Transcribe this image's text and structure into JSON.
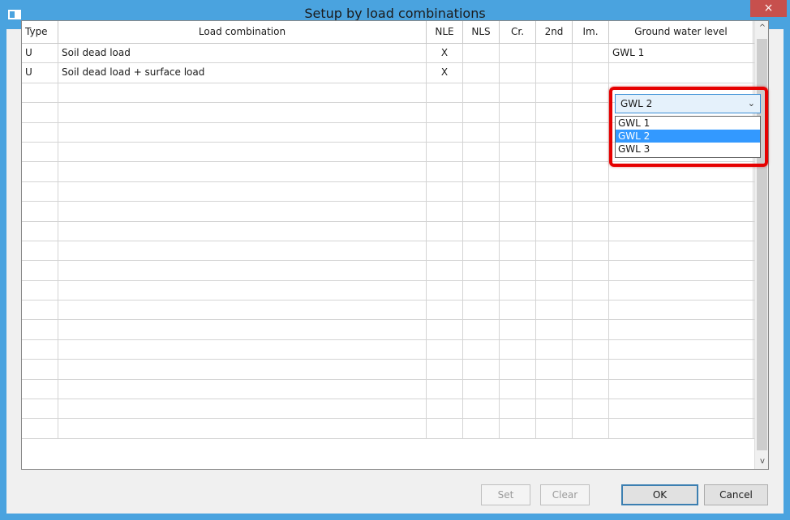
{
  "window": {
    "title": "Setup by load combinations",
    "close_glyph": "×"
  },
  "table": {
    "headers": {
      "type": "Type",
      "load_combination": "Load combination",
      "nle": "NLE",
      "nls": "NLS",
      "cr": "Cr.",
      "second": "2nd",
      "im": "Im.",
      "gwl": "Ground water level"
    },
    "rows": [
      {
        "type": "U",
        "load_combination": "Soil dead load",
        "nle": "X",
        "nls": "",
        "cr": "",
        "second": "",
        "im": "",
        "gwl": "GWL 1"
      },
      {
        "type": "U",
        "load_combination": "Soil dead load + surface load",
        "nle": "X",
        "nls": "",
        "cr": "",
        "second": "",
        "im": "",
        "gwl": ""
      }
    ],
    "empty_row_count": 18
  },
  "gwl_combo": {
    "value": "GWL 2",
    "options": [
      "GWL 1",
      "GWL 2",
      "GWL 3"
    ],
    "selected_index": 1
  },
  "scrollbar": {
    "up": "^",
    "down": "v"
  },
  "buttons": {
    "set": "Set",
    "clear": "Clear",
    "ok": "OK",
    "cancel": "Cancel"
  },
  "colors": {
    "titlebar": "#4aa3df",
    "highlight": "#e60000",
    "selection": "#3399ff"
  }
}
